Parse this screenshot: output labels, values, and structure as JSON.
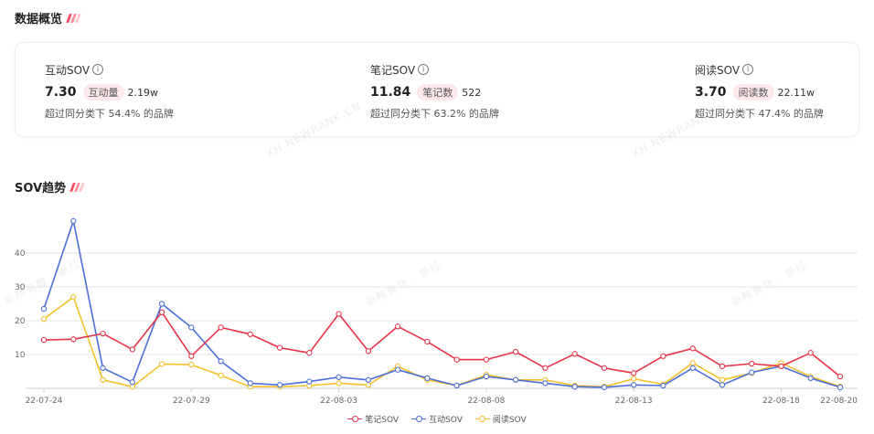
{
  "overview": {
    "title": "数据概览"
  },
  "metrics": [
    {
      "label": "互动SOV",
      "info": "i",
      "value": "7.30",
      "tag": "互动量",
      "tag_value": "2.19w",
      "desc": "超过同分类下 54.4% 的品牌"
    },
    {
      "label": "笔记SOV",
      "info": "i",
      "value": "11.84",
      "tag": "笔记数",
      "tag_value": "522",
      "desc": "超过同分类下 63.2% 的品牌"
    },
    {
      "label": "阅读SOV",
      "info": "i",
      "value": "3.70",
      "tag": "阅读数",
      "tag_value": "22.11w",
      "desc": "超过同分类下 47.4% 的品牌"
    }
  ],
  "trend": {
    "title": "SOV趋势"
  },
  "watermarks": [
    "XH.NEWRANK.CN",
    "XH.NEWRANK.CN",
    "新榜有数 · 新红",
    "新榜有数 · 新红",
    "新榜有数 · 新红"
  ],
  "colors": {
    "accent": "#ff4d6a",
    "note": "#e8334a",
    "interact": "#4a6fd9",
    "read": "#f5c02a"
  },
  "chart_data": {
    "type": "line",
    "x": [
      "22-07-24",
      "22-07-25",
      "22-07-26",
      "22-07-27",
      "22-07-28",
      "22-07-29",
      "22-07-30",
      "22-07-31",
      "22-08-01",
      "22-08-02",
      "22-08-03",
      "22-08-04",
      "22-08-05",
      "22-08-06",
      "22-08-07",
      "22-08-08",
      "22-08-09",
      "22-08-10",
      "22-08-11",
      "22-08-12",
      "22-08-13",
      "22-08-14",
      "22-08-15",
      "22-08-16",
      "22-08-17",
      "22-08-18",
      "22-08-19",
      "22-08-20"
    ],
    "xticks": [
      "22-07-24",
      "22-07-29",
      "22-08-03",
      "22-08-08",
      "22-08-13",
      "22-08-18",
      "22-08-20"
    ],
    "yticks": [
      10,
      20,
      30,
      40
    ],
    "ylim": [
      0,
      50
    ],
    "grid": true,
    "legend_position": "bottom-center",
    "series": [
      {
        "name": "笔记SOV",
        "color": "#e8334a",
        "values": [
          14.3,
          14.5,
          16.2,
          11.5,
          22.5,
          9.5,
          18.0,
          16.0,
          12.0,
          10.5,
          22.0,
          11.0,
          18.3,
          13.8,
          8.5,
          8.5,
          10.8,
          6.0,
          10.2,
          6.0,
          4.5,
          9.5,
          11.8,
          6.5,
          7.3,
          6.5,
          10.5,
          3.5
        ]
      },
      {
        "name": "互动SOV",
        "color": "#4a6fd9",
        "values": [
          23.5,
          49.5,
          6.0,
          1.8,
          25.0,
          18.0,
          8.0,
          1.5,
          1.0,
          2.0,
          3.3,
          2.5,
          5.5,
          3.0,
          0.8,
          3.5,
          2.5,
          1.5,
          0.5,
          0.3,
          1.0,
          0.8,
          6.0,
          1.0,
          4.7,
          6.5,
          3.0,
          0.3
        ]
      },
      {
        "name": "阅读SOV",
        "color": "#f5c02a",
        "values": [
          20.5,
          27.0,
          2.5,
          0.5,
          7.2,
          7.0,
          3.8,
          0.5,
          0.5,
          0.8,
          1.5,
          1.0,
          6.5,
          2.5,
          0.8,
          4.0,
          2.5,
          2.5,
          0.8,
          0.5,
          2.8,
          1.2,
          7.5,
          2.5,
          4.5,
          7.5,
          3.5,
          0.5
        ]
      }
    ]
  }
}
